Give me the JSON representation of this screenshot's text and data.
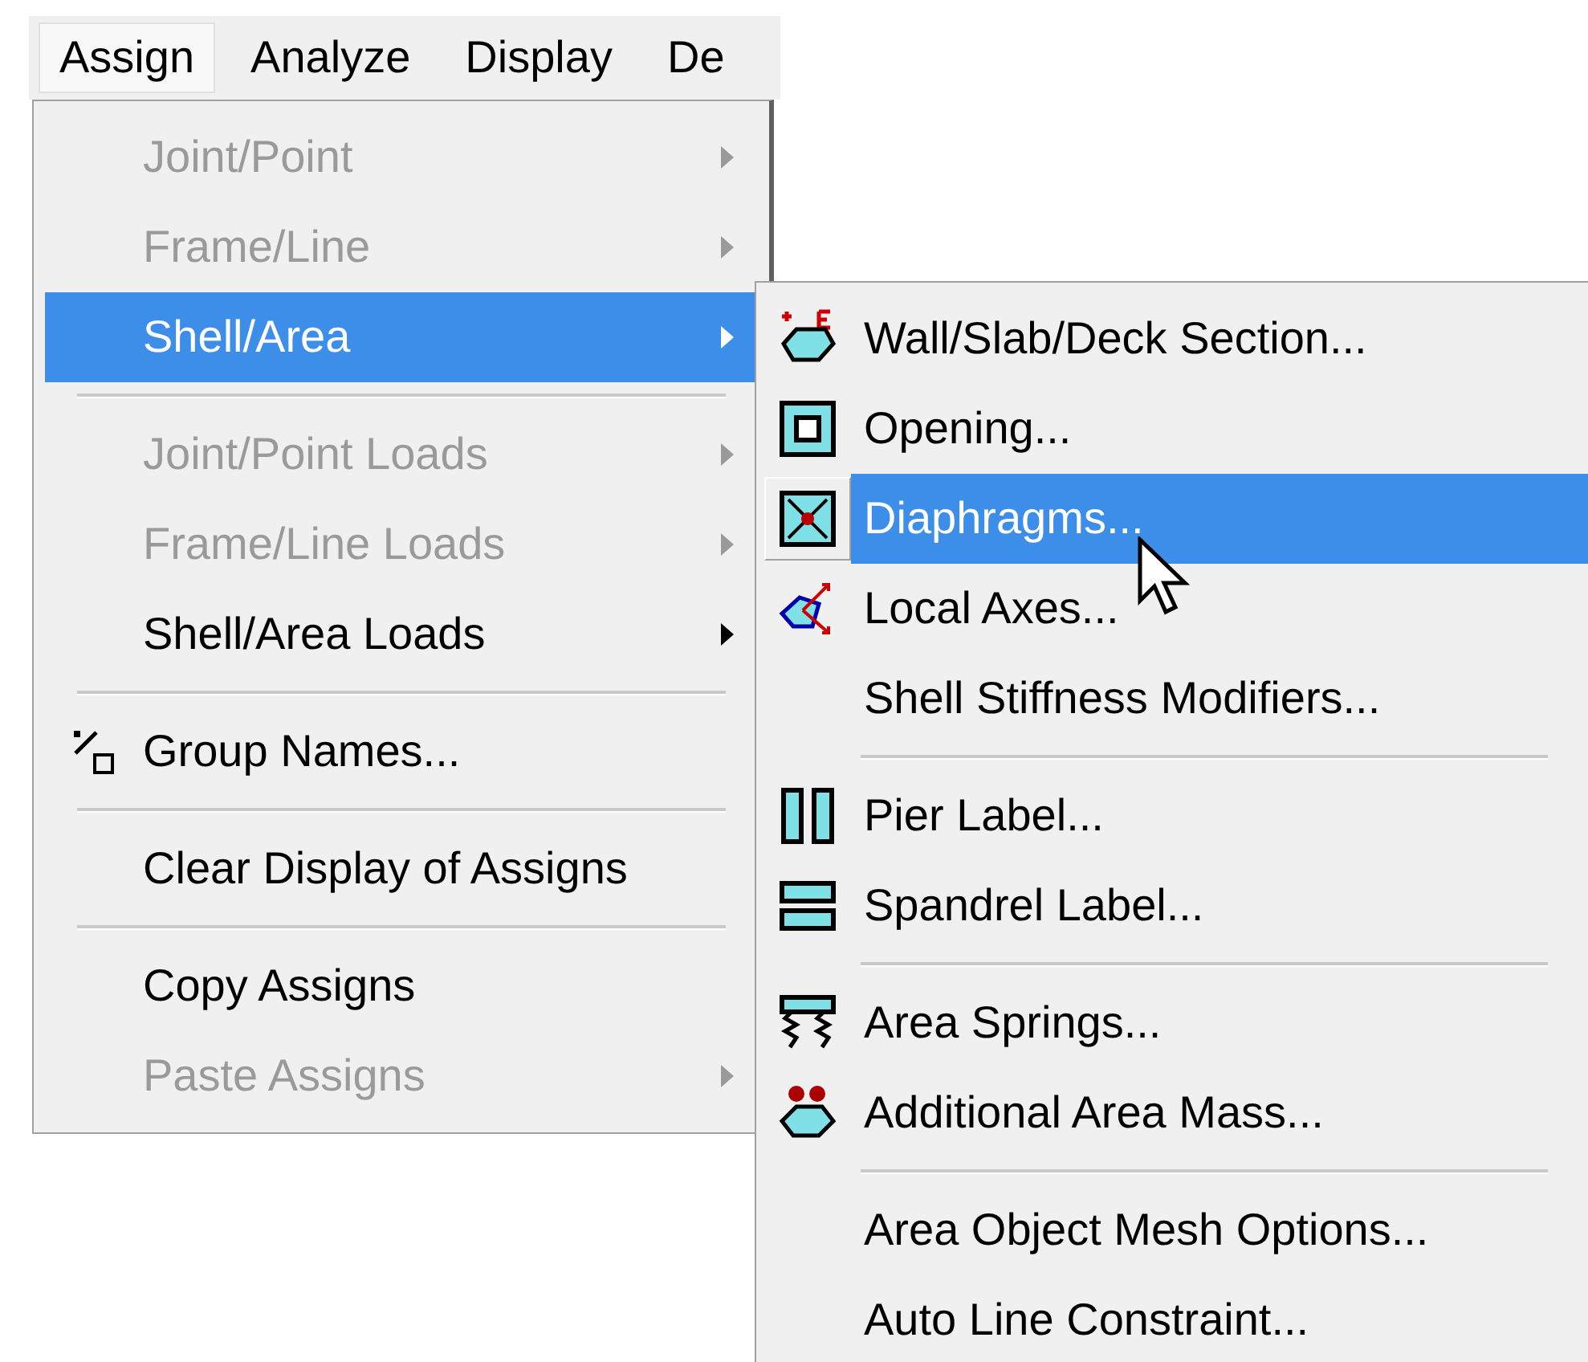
{
  "menu_bar": [
    {
      "label": "Assign",
      "selected": true
    },
    {
      "label": "Analyze",
      "selected": false
    },
    {
      "label": "Display",
      "selected": false
    },
    {
      "label": "De",
      "selected": false
    }
  ],
  "menu": {
    "items": [
      {
        "kind": "item",
        "label": "Joint/Point",
        "disabled": true,
        "submenu": true,
        "selected": false
      },
      {
        "kind": "item",
        "label": "Frame/Line",
        "disabled": true,
        "submenu": true,
        "selected": false
      },
      {
        "kind": "item",
        "label": "Shell/Area",
        "disabled": false,
        "submenu": true,
        "selected": true
      },
      {
        "kind": "separator"
      },
      {
        "kind": "item",
        "label": "Joint/Point Loads",
        "disabled": true,
        "submenu": true,
        "selected": false
      },
      {
        "kind": "item",
        "label": "Frame/Line Loads",
        "disabled": true,
        "submenu": true,
        "selected": false
      },
      {
        "kind": "item",
        "label": "Shell/Area Loads",
        "disabled": false,
        "submenu": true,
        "selected": false
      },
      {
        "kind": "separator"
      },
      {
        "kind": "item",
        "label": "Group Names...",
        "disabled": false,
        "submenu": false,
        "selected": false
      },
      {
        "kind": "separator"
      },
      {
        "kind": "item",
        "label": "Clear Display of Assigns",
        "disabled": false,
        "submenu": false,
        "selected": false
      },
      {
        "kind": "separator"
      },
      {
        "kind": "item",
        "label": "Copy Assigns",
        "disabled": false,
        "submenu": false,
        "selected": false
      },
      {
        "kind": "item",
        "label": "Paste Assigns",
        "disabled": true,
        "submenu": true,
        "selected": false
      }
    ]
  },
  "submenu": {
    "items": [
      {
        "kind": "item",
        "label": "Wall/Slab/Deck Section...",
        "selected": false
      },
      {
        "kind": "item",
        "label": "Opening...",
        "selected": false
      },
      {
        "kind": "item",
        "label": "Diaphragms...",
        "selected": true
      },
      {
        "kind": "item",
        "label": "Local Axes...",
        "selected": false
      },
      {
        "kind": "item",
        "label": "Shell Stiffness Modifiers...",
        "selected": false
      },
      {
        "kind": "separator"
      },
      {
        "kind": "item",
        "label": "Pier Label...",
        "selected": false
      },
      {
        "kind": "item",
        "label": "Spandrel Label...",
        "selected": false
      },
      {
        "kind": "separator"
      },
      {
        "kind": "item",
        "label": "Area Springs...",
        "selected": false
      },
      {
        "kind": "item",
        "label": "Additional Area Mass...",
        "selected": false
      },
      {
        "kind": "separator"
      },
      {
        "kind": "item",
        "label": "Area Object Mesh Options...",
        "selected": false
      },
      {
        "kind": "item",
        "label": "Auto Line Constraint...",
        "selected": false
      }
    ]
  }
}
